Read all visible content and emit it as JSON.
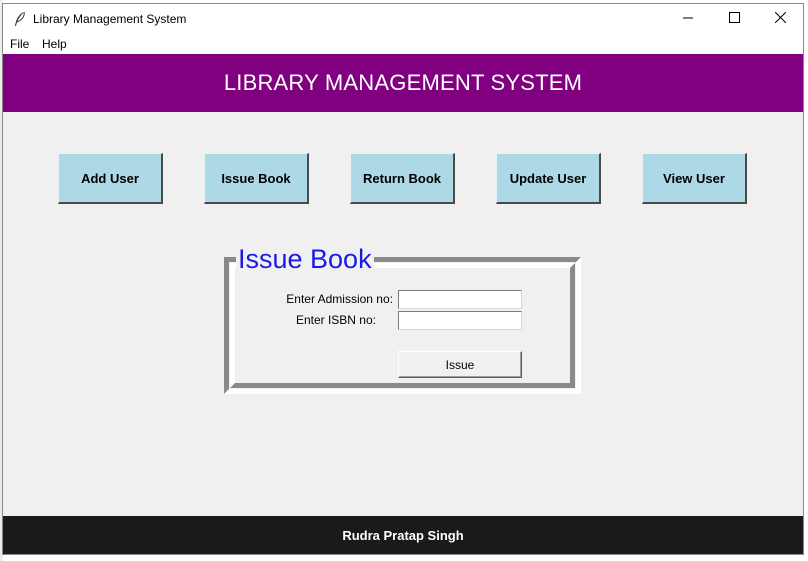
{
  "window": {
    "title": "Library Management System",
    "icon": "feather-icon",
    "controls": [
      "minimize-icon",
      "maximize-icon",
      "close-icon"
    ]
  },
  "menu": {
    "items": [
      {
        "label": "File"
      },
      {
        "label": "Help"
      }
    ]
  },
  "header": {
    "title": "LIBRARY MANAGEMENT SYSTEM",
    "background": "#800080"
  },
  "nav": {
    "buttons": [
      {
        "label": "Add User"
      },
      {
        "label": "Issue Book"
      },
      {
        "label": "Return Book"
      },
      {
        "label": "Update User"
      },
      {
        "label": "View User"
      }
    ],
    "button_color": "#add8e6"
  },
  "issue_form": {
    "title": "Issue Book",
    "title_color": "#1a1ae6",
    "admission_label": "Enter Admission no:",
    "admission_value": "",
    "isbn_label": "Enter ISBN no:",
    "isbn_value": "",
    "submit_label": "Issue"
  },
  "footer": {
    "text": "Rudra Pratap Singh",
    "background": "#1a1a1a"
  }
}
